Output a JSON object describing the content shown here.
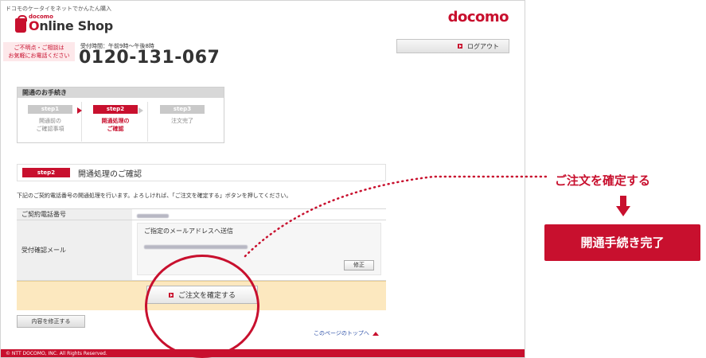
{
  "header": {
    "top_note": "ドコモのケータイをネットでかんたん購入",
    "logo_small": "docomo",
    "logo_main_prefix": "O",
    "logo_main_rest": "nline Shop",
    "brand": "docomo"
  },
  "contact": {
    "box_line1": "ご不明点・ご相談は",
    "box_line2": "お気軽にお電話ください",
    "hours": "受付時間：午前9時〜午後8時",
    "phone": "0120-131-067"
  },
  "logout_label": "ログアウト",
  "steps": {
    "header": "開通のお手続き",
    "items": [
      {
        "pill": "step1",
        "line1": "開通前の",
        "line2": "ご確認事項"
      },
      {
        "pill": "step2",
        "line1": "開通処理の",
        "line2": "ご確認"
      },
      {
        "pill": "step3",
        "line1": "注文完了",
        "line2": ""
      }
    ]
  },
  "section": {
    "pill": "step2",
    "title": "開通処理のご確認",
    "instruction": "下記のご契約電話番号の開通処理を行います。よろしければ、「ご注文を確定する」ボタンを押してください。"
  },
  "table": {
    "phone_label": "ご契約電話番号",
    "mail_label": "受付確認メール",
    "mail_box_title": "ご指定のメールアドレスへ送信",
    "edit_label": "修正"
  },
  "confirm_label": "ご注文を確定する",
  "revise_label": "内容を修正する",
  "page_top_label": "このページのトップへ",
  "footer": "© NTT DOCOMO, INC. All Rights Reserved.",
  "annotation": {
    "callout_label": "ご注文を確定する",
    "result_label": "開通手続き完了"
  },
  "colors": {
    "brand_red": "#c8102e",
    "confirm_band": "#fce8bf"
  }
}
